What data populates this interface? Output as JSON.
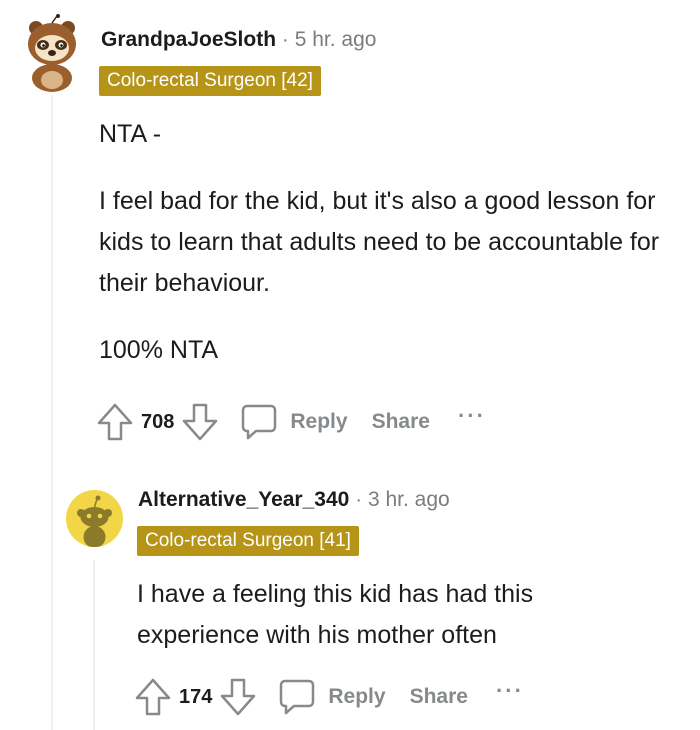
{
  "comments": [
    {
      "username": "GrandpaJoeSloth",
      "separator": "·",
      "time": "5 hr. ago",
      "flair": "Colo-rectal Surgeon [42]",
      "paragraphs": [
        "NTA -",
        "I feel bad for the kid, but it's also a good lesson for kids to learn that adults need to be accountable for their behaviour.",
        "100% NTA"
      ],
      "votes": "708",
      "reply_label": "Reply",
      "share_label": "Share",
      "more_label": "···",
      "avatar_icon": "sloth-avatar-icon"
    },
    {
      "username": "Alternative_Year_340",
      "separator": "·",
      "time": "3 hr. ago",
      "flair": "Colo-rectal Surgeon [41]",
      "paragraphs": [
        "I have a feeling this kid has had this experience with his mother often"
      ],
      "votes": "174",
      "reply_label": "Reply",
      "share_label": "Share",
      "more_label": "···",
      "avatar_icon": "snoo-avatar-icon"
    }
  ],
  "colors": {
    "flair_bg": "#b59418",
    "meta_gray": "#7c7c7c",
    "action_gray": "#878a8c",
    "avatar2_bg": "#f2d647"
  }
}
